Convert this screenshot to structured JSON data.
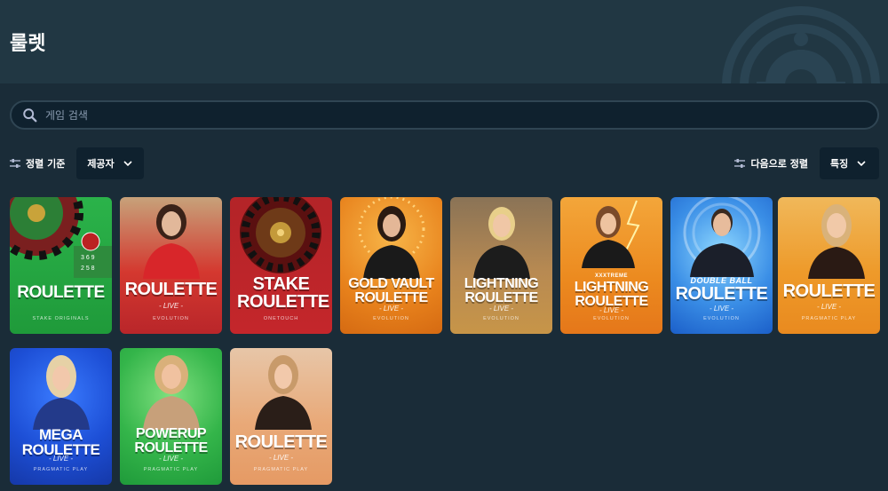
{
  "header": {
    "title": "룰렛"
  },
  "search": {
    "placeholder": "게임 검색"
  },
  "sort_left": {
    "label": "정렬 기준",
    "value": "제공자"
  },
  "sort_right": {
    "label": "다음으로 정렬",
    "value": "특징"
  },
  "games": [
    {
      "title": "ROULETTE",
      "sub": "",
      "provider": "STAKE ORIGINALS",
      "top": ""
    },
    {
      "title": "ROULETTE",
      "sub": "- LIVE -",
      "provider": "EVOLUTION",
      "top": ""
    },
    {
      "title": "STAKE ROULETTE",
      "sub": "",
      "provider": "ONETOUCH",
      "top": ""
    },
    {
      "title": "GOLD VAULT ROULETTE",
      "sub": "- LIVE -",
      "provider": "EVOLUTION",
      "top": ""
    },
    {
      "title": "LIGHTNING ROULETTE",
      "sub": "- LIVE -",
      "provider": "EVOLUTION",
      "top": ""
    },
    {
      "title": "LIGHTNING ROULETTE",
      "sub": "- LIVE -",
      "provider": "EVOLUTION",
      "top": "XXXTREME"
    },
    {
      "title": "ROULETTE",
      "sub": "- LIVE -",
      "provider": "EVOLUTION",
      "top": "DOUBLE BALL"
    },
    {
      "title": "ROULETTE",
      "sub": "- LIVE -",
      "provider": "PRAGMATIC PLAY",
      "top": ""
    },
    {
      "title": "MEGA ROULETTE",
      "sub": "- LIVE -",
      "provider": "PRAGMATIC PLAY",
      "top": ""
    },
    {
      "title": "POWERUP ROULETTE",
      "sub": "- LIVE -",
      "provider": "PRAGMATIC PLAY",
      "top": ""
    },
    {
      "title": "ROULETTE",
      "sub": "- LIVE -",
      "provider": "PRAGMATIC PLAY",
      "top": ""
    }
  ],
  "colors": {
    "page_bg": "#1a2c38",
    "hero_bg": "#213743",
    "input_bg": "#0f212e",
    "border": "#2f4553"
  }
}
